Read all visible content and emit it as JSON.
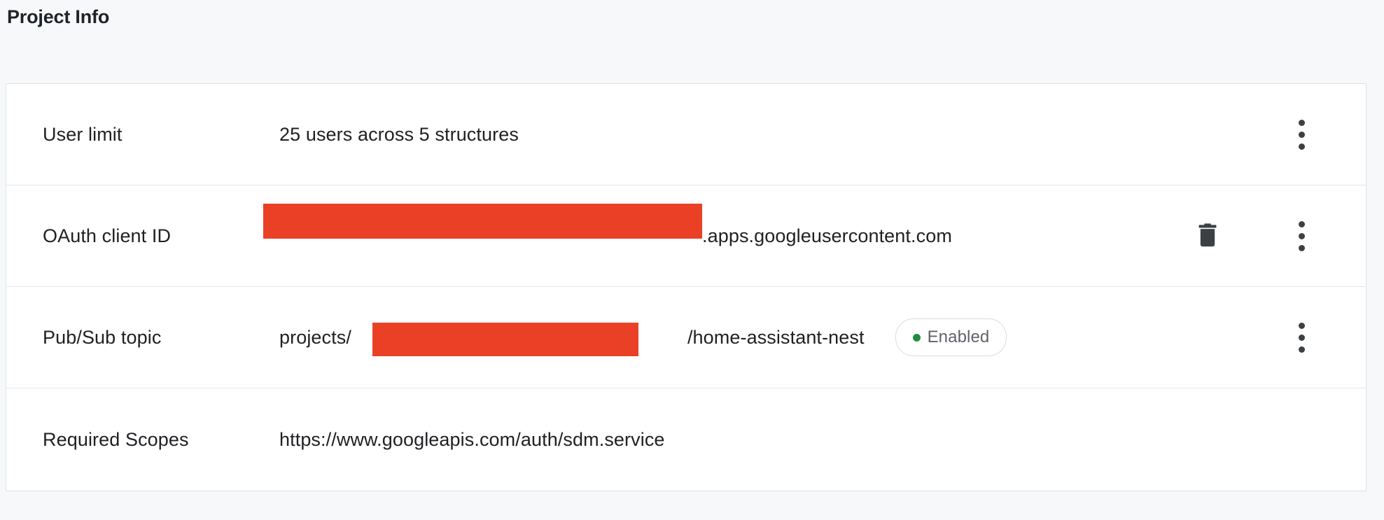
{
  "page": {
    "title": "Project Info",
    "background_color": "#f6f8fa",
    "card_background": "#ffffff",
    "card_border_color": "#dfe1e5",
    "redaction_color": "#ea4126"
  },
  "rows": [
    {
      "label": "User limit",
      "value": "25 users across 5 structures",
      "has_redaction": false,
      "has_delete": false,
      "has_menu": true
    },
    {
      "label": "OAuth client ID",
      "value_suffix": ".apps.googleusercontent.com",
      "has_redaction": true,
      "has_delete": true,
      "has_menu": true
    },
    {
      "label": "Pub/Sub topic",
      "value_prefix": "projects/",
      "value_suffix": "/home-assistant-nest",
      "has_redaction": true,
      "has_delete": false,
      "has_menu": true,
      "status": {
        "label": "Enabled",
        "dot_color": "#1e8e3e",
        "text_color": "#5f6368",
        "border_color": "#dadce0"
      }
    },
    {
      "label": "Required Scopes",
      "value": "https://www.googleapis.com/auth/sdm.service",
      "has_redaction": false,
      "has_delete": false,
      "has_menu": false
    }
  ],
  "icons": {
    "delete_label": "delete",
    "menu_label": "more options"
  }
}
